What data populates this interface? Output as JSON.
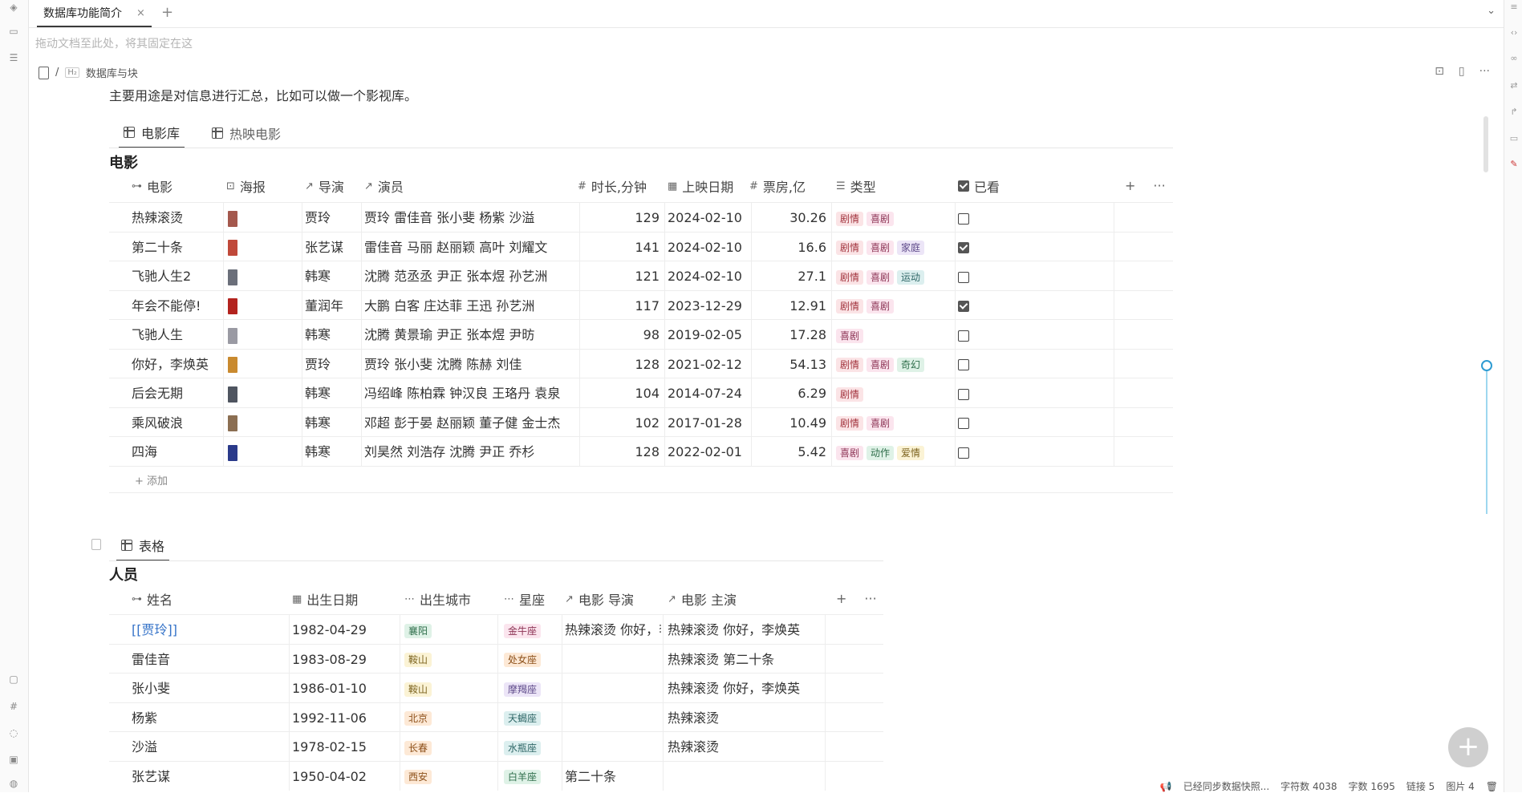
{
  "tabbar": {
    "tab_title": "数据库功能简介",
    "close_glyph": "×",
    "add_glyph": "+",
    "more_glyph": "⌄"
  },
  "pin_hint": "拖动文档至此处，将其固定在这",
  "breadcrumb": {
    "sep": "/",
    "h_icon": "H₂",
    "heading": "数据库与块"
  },
  "paragraph": "主要用途是对信息进行汇总，比如可以做一个影视库。",
  "db1": {
    "views": [
      {
        "label": "电影库"
      },
      {
        "label": "热映电影"
      }
    ],
    "title": "电影",
    "headers": {
      "movie": "电影",
      "poster": "海报",
      "director": "导演",
      "cast": "演员",
      "duration": "时长,分钟",
      "release": "上映日期",
      "box": "票房,亿",
      "genre": "类型",
      "watched": "已看"
    },
    "header_icons": {
      "movie": "⊶",
      "poster": "⊡",
      "director": "↗",
      "cast": "↗",
      "duration": "#",
      "release": "▦",
      "box": "#",
      "genre": "☰"
    },
    "tools": {
      "add": "+",
      "more": "···"
    },
    "rows": [
      {
        "movie": "热辣滚烫",
        "poster_color": "#a4584d",
        "director": "贾玲",
        "cast": "贾玲  雷佳音  张小斐  杨紫  沙溢",
        "duration": "129",
        "release": "2024-02-10",
        "box": "30.26",
        "genres": [
          {
            "t": "剧情",
            "c": "red"
          },
          {
            "t": "喜剧",
            "c": "pink"
          }
        ],
        "watched": false
      },
      {
        "movie": "第二十条",
        "poster_color": "#c0493a",
        "director": "张艺谋",
        "cast": "雷佳音  马丽  赵丽颖  高叶  刘耀文",
        "duration": "141",
        "release": "2024-02-10",
        "box": "16.6",
        "genres": [
          {
            "t": "剧情",
            "c": "red"
          },
          {
            "t": "喜剧",
            "c": "pink"
          },
          {
            "t": "家庭",
            "c": "purple"
          }
        ],
        "watched": true
      },
      {
        "movie": "飞驰人生2",
        "poster_color": "#6b6f7a",
        "director": "韩寒",
        "cast": "沈腾  范丞丞  尹正  张本煜  孙艺洲",
        "duration": "121",
        "release": "2024-02-10",
        "box": "27.1",
        "genres": [
          {
            "t": "剧情",
            "c": "red"
          },
          {
            "t": "喜剧",
            "c": "pink"
          },
          {
            "t": "运动",
            "c": "teal"
          }
        ],
        "watched": false
      },
      {
        "movie": "年会不能停!",
        "poster_color": "#b3231e",
        "director": "董润年",
        "cast": "大鹏  白客  庄达菲  王迅  孙艺洲",
        "duration": "117",
        "release": "2023-12-29",
        "box": "12.91",
        "genres": [
          {
            "t": "剧情",
            "c": "red"
          },
          {
            "t": "喜剧",
            "c": "pink"
          }
        ],
        "watched": true
      },
      {
        "movie": "飞驰人生",
        "poster_color": "#9a9aa3",
        "director": "韩寒",
        "cast": "沈腾  黄景瑜  尹正  张本煜  尹昉",
        "duration": "98",
        "release": "2019-02-05",
        "box": "17.28",
        "genres": [
          {
            "t": "喜剧",
            "c": "pink"
          }
        ],
        "watched": false
      },
      {
        "movie": "你好，李焕英",
        "poster_color": "#c98a2f",
        "director": "贾玲",
        "cast": "贾玲  张小斐  沈腾  陈赫  刘佳",
        "duration": "128",
        "release": "2021-02-12",
        "box": "54.13",
        "genres": [
          {
            "t": "剧情",
            "c": "red"
          },
          {
            "t": "喜剧",
            "c": "pink"
          },
          {
            "t": "奇幻",
            "c": "green"
          }
        ],
        "watched": false
      },
      {
        "movie": "后会无期",
        "poster_color": "#4f5560",
        "director": "韩寒",
        "cast": "冯绍峰  陈柏霖  钟汉良  王珞丹  袁泉",
        "duration": "104",
        "release": "2014-07-24",
        "box": "6.29",
        "genres": [
          {
            "t": "剧情",
            "c": "red"
          }
        ],
        "watched": false
      },
      {
        "movie": "乘风破浪",
        "poster_color": "#8b6e52",
        "director": "韩寒",
        "cast": "邓超  彭于晏  赵丽颖  董子健  金士杰",
        "duration": "102",
        "release": "2017-01-28",
        "box": "10.49",
        "genres": [
          {
            "t": "剧情",
            "c": "red"
          },
          {
            "t": "喜剧",
            "c": "pink"
          }
        ],
        "watched": false
      },
      {
        "movie": "四海",
        "poster_color": "#2a3a8a",
        "director": "韩寒",
        "cast": "刘昊然  刘浩存  沈腾  尹正  乔杉",
        "duration": "128",
        "release": "2022-02-01",
        "box": "5.42",
        "genres": [
          {
            "t": "喜剧",
            "c": "pink"
          },
          {
            "t": "动作",
            "c": "green"
          },
          {
            "t": "爱情",
            "c": "yellow"
          }
        ],
        "watched": false
      }
    ],
    "add_label": "+ 添加"
  },
  "db2": {
    "views": [
      {
        "label": "表格"
      }
    ],
    "title": "人员",
    "headers": {
      "name": "姓名",
      "birth": "出生日期",
      "city": "出生城市",
      "sign": "星座",
      "movie_director": "电影 导演",
      "movie_cast": "电影 主演"
    },
    "header_icons": {
      "name": "⊶",
      "birth": "▦",
      "city": "⋯",
      "sign": "⋯",
      "movie_director": "↗",
      "movie_cast": "↗"
    },
    "tools": {
      "add": "+",
      "more": "···"
    },
    "rows": [
      {
        "name": "[[贾玲]]",
        "is_link": true,
        "birth": "1982-04-29",
        "city": {
          "t": "襄阳",
          "c": "green"
        },
        "sign": {
          "t": "金牛座",
          "c": "pink"
        },
        "movie_director": "热辣滚烫  你好，李焕英",
        "movie_cast": "热辣滚烫  你好，李焕英"
      },
      {
        "name": "雷佳音",
        "birth": "1983-08-29",
        "city": {
          "t": "鞍山",
          "c": "yellow"
        },
        "sign": {
          "t": "处女座",
          "c": "orange"
        },
        "movie_director": "",
        "movie_cast": "热辣滚烫  第二十条"
      },
      {
        "name": "张小斐",
        "birth": "1986-01-10",
        "city": {
          "t": "鞍山",
          "c": "yellow"
        },
        "sign": {
          "t": "摩羯座",
          "c": "purple"
        },
        "movie_director": "",
        "movie_cast": "热辣滚烫  你好，李焕英"
      },
      {
        "name": "杨紫",
        "birth": "1992-11-06",
        "city": {
          "t": "北京",
          "c": "orange"
        },
        "sign": {
          "t": "天蝎座",
          "c": "teal"
        },
        "movie_director": "",
        "movie_cast": "热辣滚烫"
      },
      {
        "name": "沙溢",
        "birth": "1978-02-15",
        "city": {
          "t": "长春",
          "c": "orange"
        },
        "sign": {
          "t": "水瓶座",
          "c": "teal"
        },
        "movie_director": "",
        "movie_cast": "热辣滚烫"
      },
      {
        "name": "张艺谋",
        "birth": "1950-04-02",
        "city": {
          "t": "西安",
          "c": "orange"
        },
        "sign": {
          "t": "白羊座",
          "c": "green"
        },
        "movie_director": "第二十条",
        "movie_cast": ""
      }
    ]
  },
  "status": {
    "sync": "已经同步数据快照...",
    "chars": "字符数 4038",
    "words": "字数 1695",
    "links": "链接 5",
    "images": "图片 4"
  },
  "fab_glyph": "+"
}
